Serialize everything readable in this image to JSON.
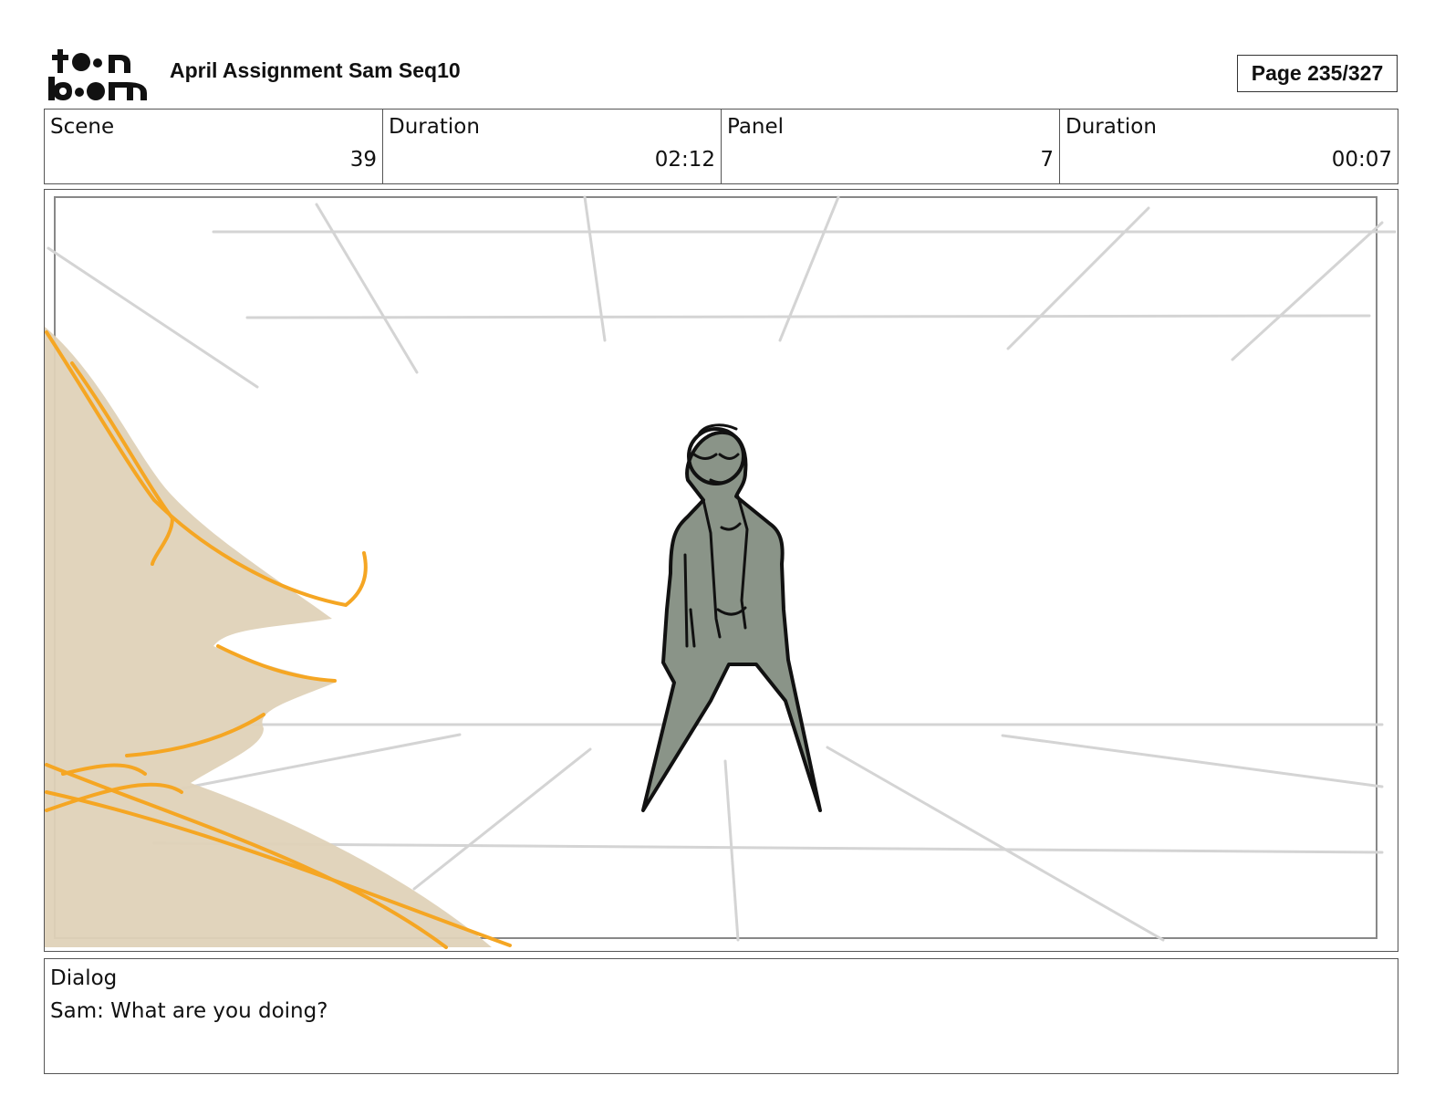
{
  "header": {
    "logo_text": "toon boom",
    "project_title": "April Assignment Sam Seq10",
    "page_label": "Page 235/327"
  },
  "info": {
    "scene_label": "Scene",
    "scene_value": "39",
    "scene_duration_label": "Duration",
    "scene_duration_value": "02:12",
    "panel_label": "Panel",
    "panel_value": "7",
    "panel_duration_label": "Duration",
    "panel_duration_value": "00:07"
  },
  "dialog": {
    "label": "Dialog",
    "text": "Sam: What are you doing?"
  },
  "colors": {
    "border": "#555555",
    "perspective_lines": "#d4d4d4",
    "foreground_fill": "#dfd2b8",
    "foreground_lines": "#f5a623",
    "figure_fill": "#8a9488",
    "figure_outline": "#111111"
  }
}
